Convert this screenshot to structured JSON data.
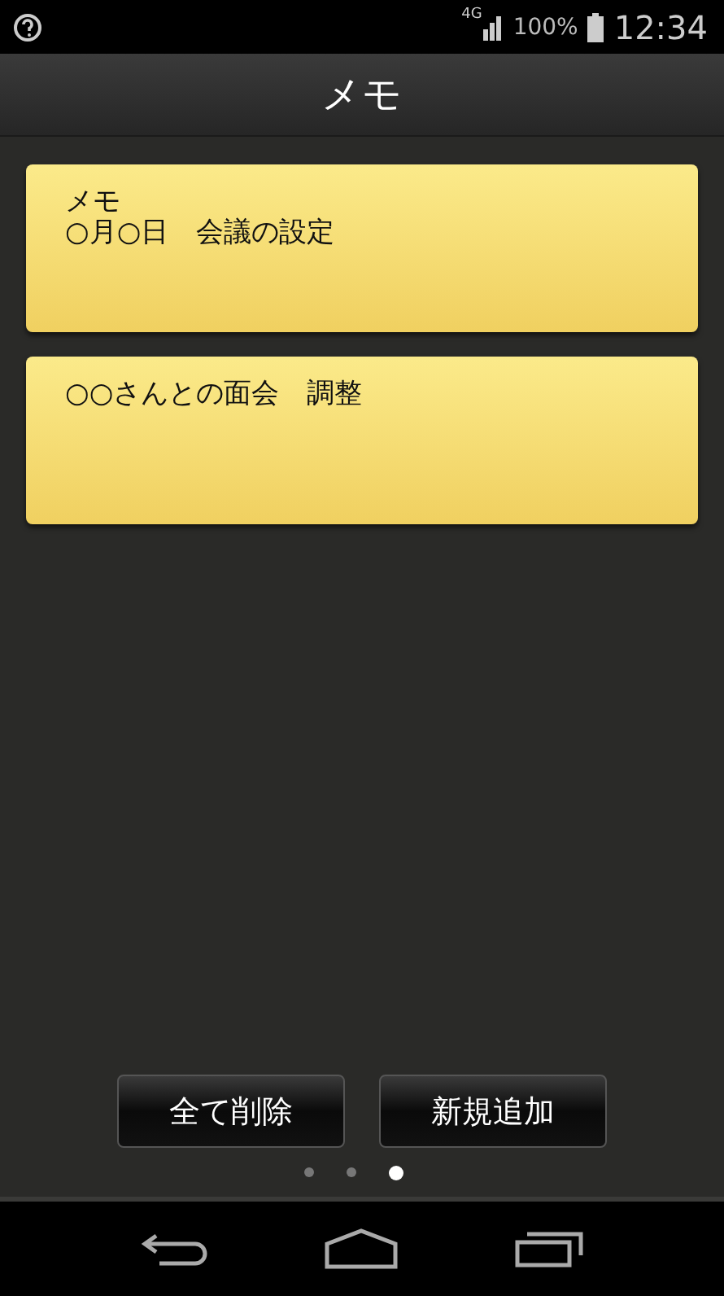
{
  "status_bar": {
    "network": "4G",
    "battery": "100%",
    "time": "12:34"
  },
  "title": "メモ",
  "memos": [
    {
      "lines": [
        "メモ",
        "○月○日　会議の設定"
      ]
    },
    {
      "lines": [
        "○○さんとの面会　調整"
      ]
    }
  ],
  "buttons": [
    "全て削除",
    "新規追加"
  ],
  "pages": [
    {
      "selected": false
    },
    {
      "selected": false
    },
    {
      "selected": true
    }
  ]
}
